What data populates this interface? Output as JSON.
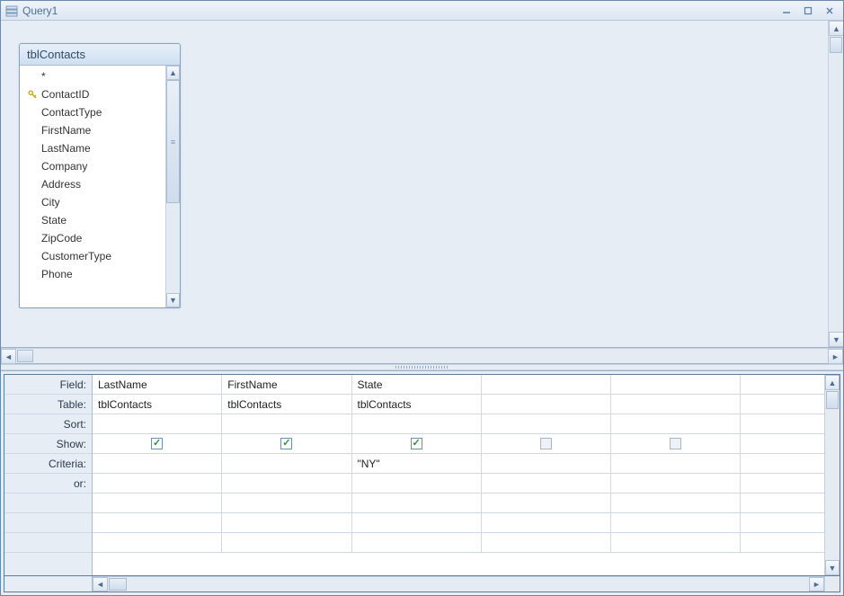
{
  "window": {
    "title": "Query1"
  },
  "table_box": {
    "name": "tblContacts",
    "fields": [
      {
        "label": "*",
        "pk": false,
        "star": true
      },
      {
        "label": "ContactID",
        "pk": true
      },
      {
        "label": "ContactType",
        "pk": false
      },
      {
        "label": "FirstName",
        "pk": false
      },
      {
        "label": "LastName",
        "pk": false
      },
      {
        "label": "Company",
        "pk": false
      },
      {
        "label": "Address",
        "pk": false
      },
      {
        "label": "City",
        "pk": false
      },
      {
        "label": "State",
        "pk": false
      },
      {
        "label": "ZipCode",
        "pk": false
      },
      {
        "label": "CustomerType",
        "pk": false
      },
      {
        "label": "Phone",
        "pk": false
      }
    ]
  },
  "qbe": {
    "row_labels": [
      "Field:",
      "Table:",
      "Sort:",
      "Show:",
      "Criteria:",
      "or:"
    ],
    "columns": [
      {
        "field": "LastName",
        "table": "tblContacts",
        "sort": "",
        "show": true,
        "criteria": "",
        "or": ""
      },
      {
        "field": "FirstName",
        "table": "tblContacts",
        "sort": "",
        "show": true,
        "criteria": "",
        "or": ""
      },
      {
        "field": "State",
        "table": "tblContacts",
        "sort": "",
        "show": true,
        "criteria": "\"NY\"",
        "or": ""
      },
      {
        "field": "",
        "table": "",
        "sort": "",
        "show": false,
        "criteria": "",
        "or": "",
        "gray": true
      },
      {
        "field": "",
        "table": "",
        "sort": "",
        "show": false,
        "criteria": "",
        "or": "",
        "gray": true
      }
    ]
  }
}
